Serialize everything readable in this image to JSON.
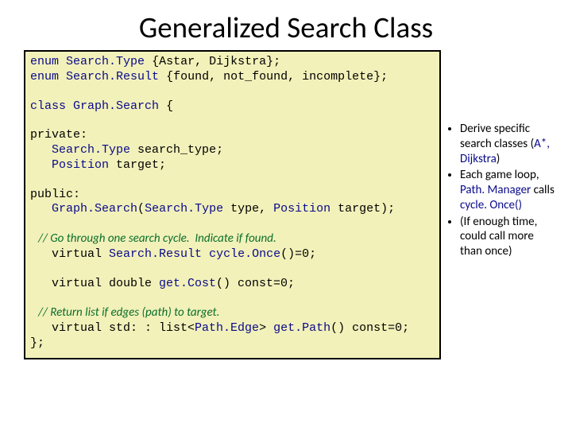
{
  "title": "Generalized Search Class",
  "code": {
    "l1a": "enum",
    "l1b": "Search.Type",
    "l1c": " {Astar, Dijkstra};",
    "l2a": "enum",
    "l2b": "Search.Result",
    "l2c": " {found, not_found, incomplete};",
    "l3a": "class",
    "l3b": "Graph.Search",
    "l3c": " {",
    "l4": "private:",
    "l5a": "   ",
    "l5b": "Search.Type",
    "l5c": " search_type;",
    "l6a": "   ",
    "l6b": "Position",
    "l6c": " target;",
    "l7": "public:",
    "l8a": "   ",
    "l8b": "Graph.Search",
    "l8c": "(",
    "l8d": "Search.Type",
    "l8e": " type, ",
    "l8f": "Position",
    "l8g": " target);",
    "c1": "   // Go through one search cycle.  Indicate if found.",
    "l9a": "   virtual ",
    "l9b": "Search.Result",
    "l9c": " ",
    "l9d": "cycle.Once",
    "l9e": "()=0;",
    "l10a": "   virtual double ",
    "l10b": "get.Cost",
    "l10c": "() const=0;",
    "c2": "   // Return list if edges (path) to target.",
    "l11a": "   virtual std: : list<",
    "l11b": "Path.Edge",
    "l11c": "> ",
    "l11d": "get.Path",
    "l11e": "() const=0;",
    "l12": "};"
  },
  "bullets": {
    "b1a": "Derive specific search classes (",
    "b1b": "A*, Dijkstra",
    "b1c": ")",
    "b2a": "Each game loop, ",
    "b2b": "Path. Manager",
    "b2c": " calls ",
    "b2d": "cycle. Once()",
    "b3": "(If enough time, could call more than once)"
  }
}
